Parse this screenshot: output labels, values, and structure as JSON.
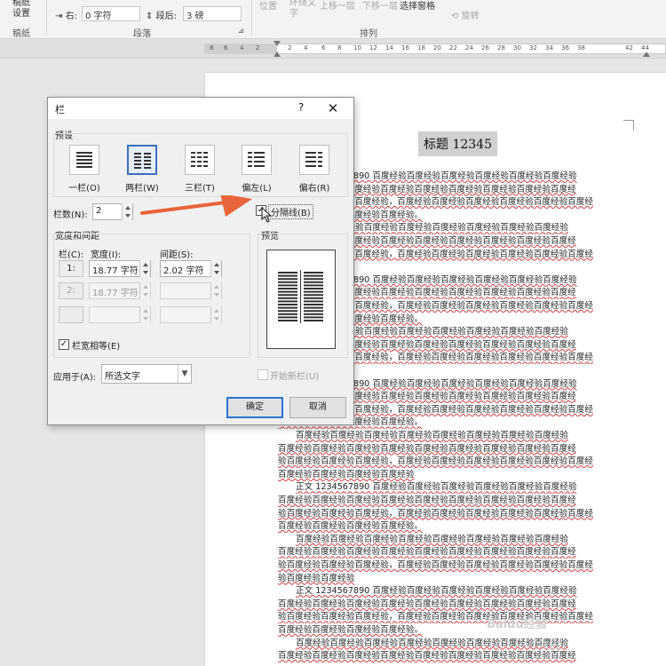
{
  "ribbon": {
    "gaozhi_label": "稿纸\n设置",
    "right_indent_label": "右:",
    "right_indent_value": "0 字符",
    "after_label": "段后:",
    "after_value": "3 磅",
    "position_label": "位置",
    "wrap_label": "环绕文\n字",
    "bring_forward_label": "上移一层",
    "send_backward_label": "下移一层",
    "select_pane_label": "选择窗格",
    "rotate_label": "旋转",
    "group_gaozhi": "稿纸",
    "group_paragraph": "段落",
    "group_arrange": "排列"
  },
  "ruler": {
    "ticks": [
      "8",
      "6",
      "4",
      "2",
      "2",
      "4",
      "6",
      "8",
      "10",
      "12",
      "14",
      "16",
      "18",
      "20",
      "22",
      "24",
      "26",
      "28",
      "30",
      "32",
      "34",
      "36",
      "38",
      "42",
      "44"
    ]
  },
  "document": {
    "title": "标题 12345",
    "lines": [
      "正文 1234567890 百度经验百度经验百度经验百度经验百度经验百度经验",
      "百度经验百度经验百度经验百度经验百度经验百度经验百度经验百度经验百度经",
      "验百度经验百度经验百度经验，百度经验百度经验百度经验百度经验百度经验百度经",
      "百度经验百度经验百度经验百度经验。",
      "百度经验百度经验百度经验百度经验百度经验百度经验百度经验百度经验",
      "百度经验百度经验百度经验百度经验百度经验百度经验百度经验百度经验百度经",
      "验百度经验百度经验百度经验，百度经验百度经验百度经验百度经验百度经验百度经",
      "百度经验百度经验",
      "正文 1234567890 百度经验百度经验百度经验百度经验百度经验百度经验",
      "百度经验百度经验百度经验百度经验百度经验百度经验百度经验百度经验百度经",
      "验百度经验百度经验百度经验，百度经验百度经验百度经验百度经验百度经验百度经",
      "百度经验百度经验百度经验百度经验。",
      "百度经验百度经验百度经验百度经验百度经验百度经验百度经验百度经验",
      "百度经验百度经验百度经验百度经验百度经验百度经验百度经验百度经验百度经",
      "验百度经验百度经验百度经验，百度经验百度经验百度经验百度经验百度经验百度经",
      "百度经验百度经验",
      "正文 1234567890 百度经验百度经验百度经验百度经验百度经验百度经验",
      "百度经验百度经验百度经验百度经验百度经验百度经验百度经验百度经验百度经",
      "验百度经验百度经验百度经验，百度经验百度经验百度经验百度经验百度经验百度经",
      "百度经验百度经验百度经验百度经验。",
      "百度经验百度经验百度经验百度经验百度经验百度经验百度经验百度经验",
      "百度经验百度经验百度经验百度经验百度经验百度经验百度经验百度经验百度经",
      "验百度经验百度经验百度经验，百度经验百度经验百度经验百度经验百度经验百度经",
      "百度经验百度经验百度经验百度经验",
      "正文 1234567890 百度经验百度经验百度经验百度经验百度经验百度经验",
      "百度经验百度经验百度经验百度经验百度经验百度经验百度经验百度经验百度经",
      "验百度经验百度经验百度经验，百度经验百度经验百度经验百度经验百度经验百度经",
      "百度经验百度经验百度经验百度经验。",
      "百度经验百度经验百度经验百度经验百度经验百度经验百度经验百度经验",
      "百度经验百度经验百度经验百度经验百度经验百度经验百度经验百度经验百度经",
      "验百度经验百度经验百度经验，百度经验百度经验百度经验百度经验百度经验百度经",
      "验百度经验百度经验",
      "正文 1234567890 百度经验百度经验百度经验百度经验百度经验百度经验",
      "百度经验百度经验百度经验百度经验百度经验百度经验百度经验百度经验百度经",
      "验百度经验百度经验百度经验，百度经验百度经验百度经验百度经验百度经验百度经",
      "百度经验百度经验百度经验百度经验。",
      "百度经验百度经验百度经验百度经验百度经验百度经验百度经验百度经验",
      "百度经验百度经验百度经验百度经验百度经验百度经验百度经验百度经验百度经"
    ]
  },
  "dialog": {
    "title": "栏",
    "help": "?",
    "close": "✕",
    "presets_label": "预设",
    "presets": [
      "一栏(O)",
      "两栏(W)",
      "三栏(T)",
      "偏左(L)",
      "偏右(R)"
    ],
    "col_count_label": "栏数(N):",
    "col_count_value": "2",
    "separator_label": "分隔线(B)",
    "separator_checked": true,
    "width_spacing_label": "宽度和间距",
    "col_header": "栏(C):",
    "width_header": "宽度(I):",
    "spacing_header": "间距(S):",
    "rows": [
      {
        "num": "1:",
        "width": "18.77 字符",
        "spacing": "2.02 字符"
      },
      {
        "num": "2:",
        "width": "18.77 字符",
        "spacing": ""
      }
    ],
    "equal_width_label": "栏宽相等(E)",
    "equal_width_checked": true,
    "preview_label": "预览",
    "apply_to_label": "应用于(A):",
    "apply_to_value": "所选文字",
    "new_column_label": "开始新栏(U)",
    "ok": "确定",
    "cancel": "取消"
  },
  "watermark": {
    "brand": "Baidu经验",
    "user": "5722"
  },
  "colors": {
    "accent_arrow": "#e8643a",
    "selected_border": "#3a6fbf",
    "button_focus": "#2a73d6"
  }
}
